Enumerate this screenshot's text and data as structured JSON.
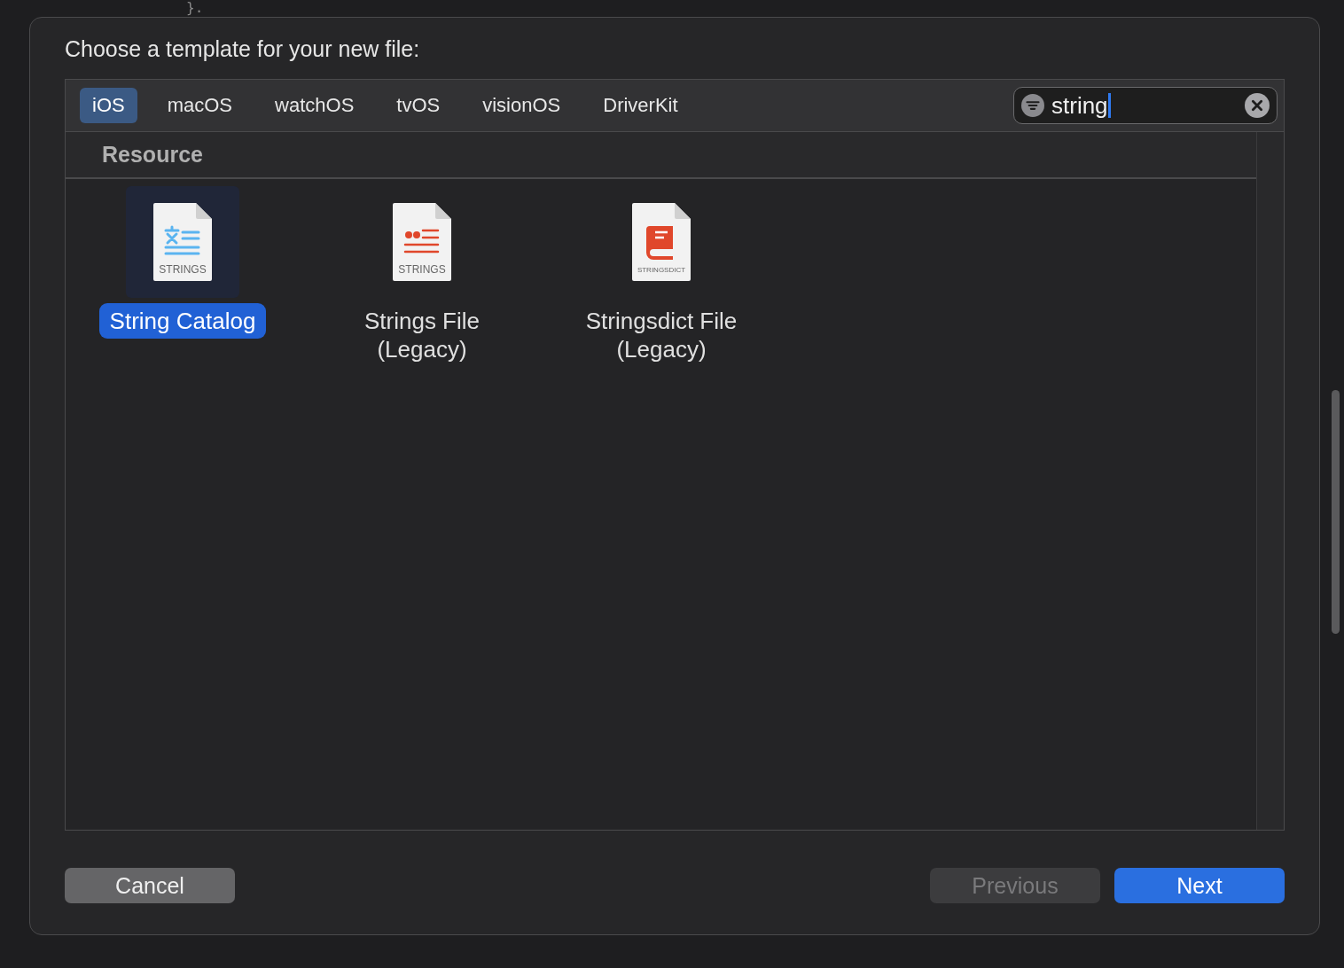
{
  "background": {
    "code_text": "}."
  },
  "dialog": {
    "title": "Choose a template for your new file:",
    "tabs": [
      {
        "label": "iOS",
        "selected": true
      },
      {
        "label": "macOS",
        "selected": false
      },
      {
        "label": "watchOS",
        "selected": false
      },
      {
        "label": "tvOS",
        "selected": false
      },
      {
        "label": "visionOS",
        "selected": false
      },
      {
        "label": "DriverKit",
        "selected": false
      }
    ],
    "search": {
      "value": "string"
    },
    "section": "Resource",
    "templates": [
      {
        "name": "String Catalog",
        "icon_label": "STRINGS",
        "kind": "catalog",
        "selected": true
      },
      {
        "name": "Strings File (Legacy)",
        "icon_label": "STRINGS",
        "kind": "strings",
        "selected": false
      },
      {
        "name": "Stringsdict File (Legacy)",
        "icon_label": "STRINGSDICT",
        "kind": "stringsdict",
        "selected": false
      }
    ],
    "buttons": [
      {
        "label": "Cancel",
        "kind": "normal",
        "disabled": false
      },
      {
        "label": "Previous",
        "kind": "normal",
        "disabled": true
      },
      {
        "label": "Next",
        "kind": "default",
        "disabled": false
      }
    ]
  }
}
